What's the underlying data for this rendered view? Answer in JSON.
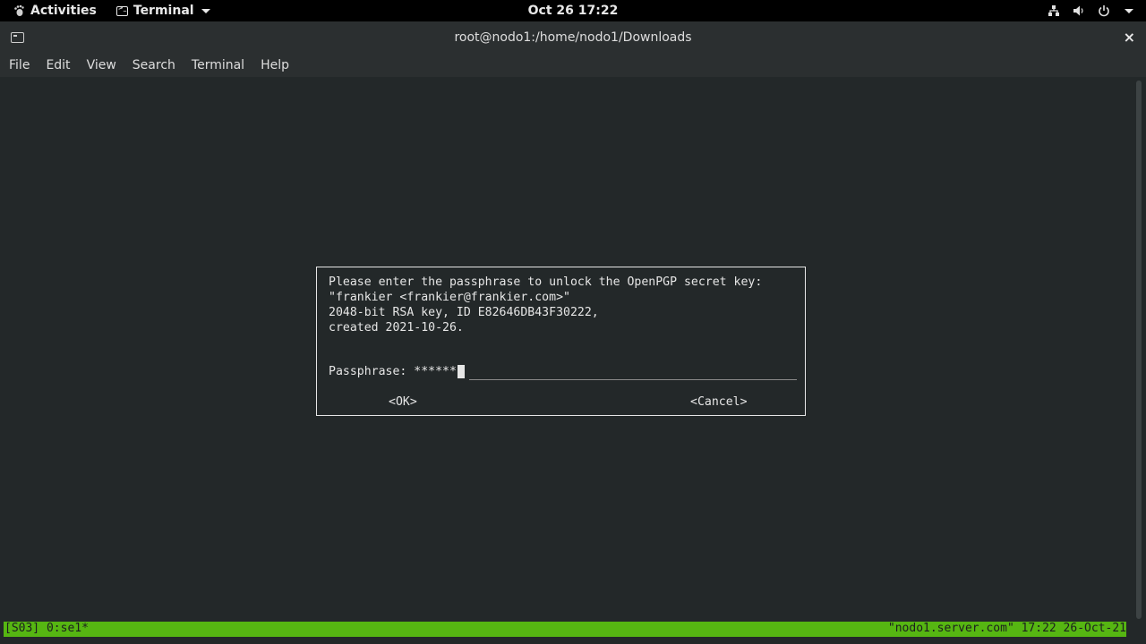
{
  "topbar": {
    "activities": "Activities",
    "app_menu": "Terminal",
    "clock": "Oct 26  17:22"
  },
  "window": {
    "title": "root@nodo1:/home/nodo1/Downloads",
    "close": "×"
  },
  "menu": {
    "items": [
      "File",
      "Edit",
      "View",
      "Search",
      "Terminal",
      "Help"
    ]
  },
  "dialog": {
    "lines": [
      "Please enter the passphrase to unlock the OpenPGP secret key:",
      "\"frankier <frankier@frankier.com>\"",
      "2048-bit RSA key, ID E82646DB43F30222,",
      "created 2021-10-26."
    ],
    "passphrase_label": "Passphrase:",
    "passphrase_value": "******",
    "ok_label": "<OK>",
    "cancel_label": "<Cancel>"
  },
  "statusbar": {
    "left": "[S03] 0:se1*",
    "right": "\"nodo1.server.com\" 17:22 26-Oct-21"
  },
  "colors": {
    "status_green": "#56b612",
    "terminal_bg": "#232829",
    "titlebar_bg": "#2b2f30"
  },
  "icons": [
    "activities-icon",
    "terminal-app-icon",
    "network-icon",
    "volume-icon",
    "power-icon",
    "terminal-window-icon"
  ]
}
